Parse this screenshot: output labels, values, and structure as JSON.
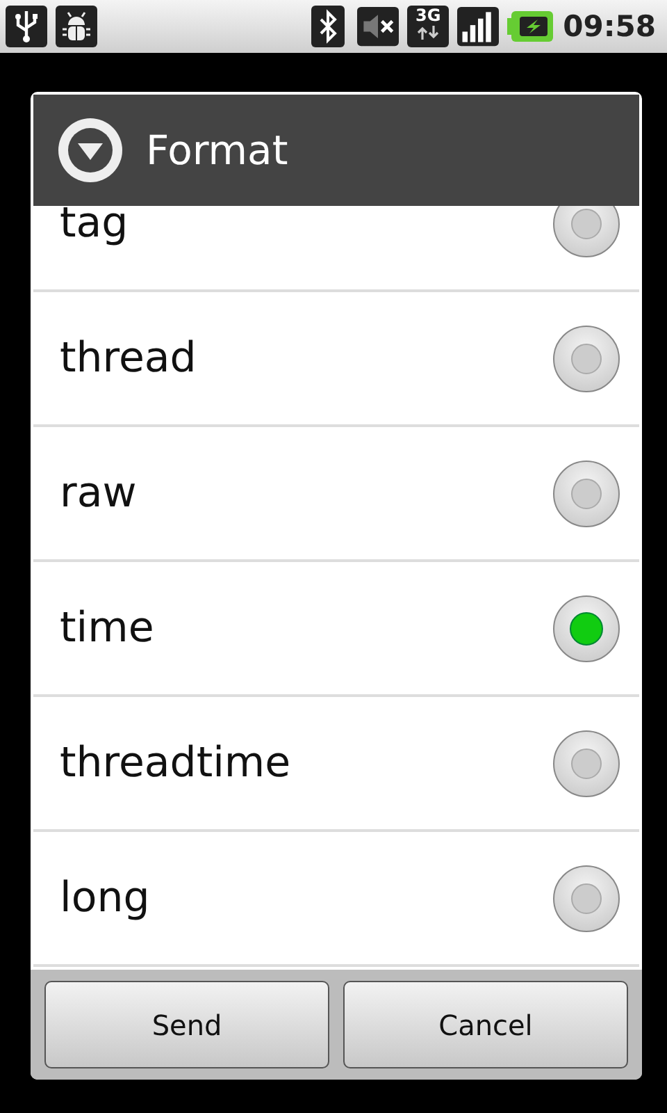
{
  "status_bar": {
    "network": "3G",
    "time": "09:58"
  },
  "dialog": {
    "title": "Format",
    "options": [
      {
        "label": "tag",
        "selected": false
      },
      {
        "label": "thread",
        "selected": false
      },
      {
        "label": "raw",
        "selected": false
      },
      {
        "label": "time",
        "selected": true
      },
      {
        "label": "threadtime",
        "selected": false
      },
      {
        "label": "long",
        "selected": false
      }
    ],
    "buttons": [
      "Send",
      "Cancel"
    ]
  }
}
